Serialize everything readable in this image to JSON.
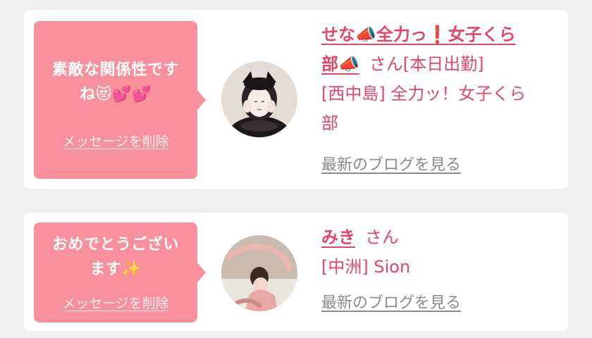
{
  "messages": [
    {
      "message_line1": "素敵な関係性です",
      "message_line2": "ね😻💕💕",
      "delete_label": "メッセージを削除",
      "cast_name_line1": "せな📣全力っ❗女子くら",
      "cast_name_line2": "部📣",
      "honorific": "さん",
      "status": "[本日出勤]",
      "shop_line1": "[西中島] 全力ッ！女子くら",
      "shop_line2": "部",
      "blog_label": "最新のブログを見る"
    },
    {
      "message_line1": "おめでとうござい",
      "message_line2": "ます✨",
      "delete_label": "メッセージを削除",
      "cast_name": "みき",
      "honorific": "さん",
      "shop": "[中洲] Sion",
      "blog_label": "最新のブログを見る"
    }
  ],
  "colors": {
    "accent": "#e0476a",
    "bubble": "#f8909b",
    "page_background": "#f0f0f0",
    "card_background": "#ffffff",
    "muted_link": "#8a8a8a"
  }
}
